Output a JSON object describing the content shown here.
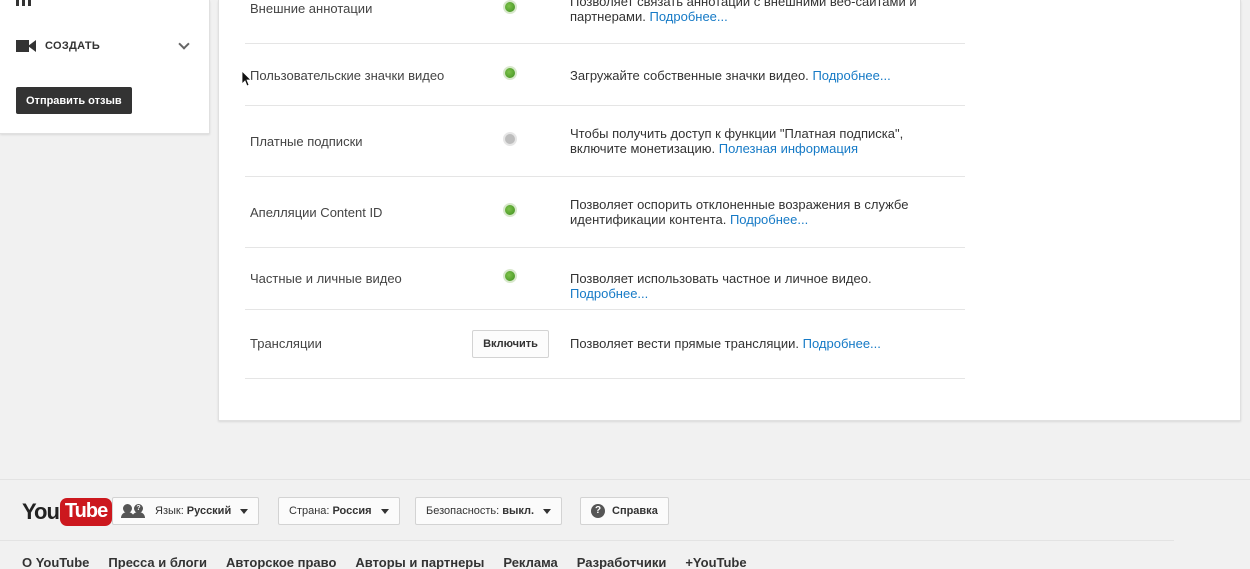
{
  "guide": {
    "create_label": "СОЗДАТЬ",
    "feedback_label": "Отправить отзыв"
  },
  "features": [
    {
      "name": "Внешние аннотации",
      "status": "on",
      "desc": "Позволяет связать аннотации с внешними веб-сайтами и партнерами.",
      "link": "Подробнее..."
    },
    {
      "name": "Пользовательские значки видео",
      "status": "on",
      "desc": "Загружайте собственные значки видео.",
      "link": "Подробнее..."
    },
    {
      "name": "Платные подписки",
      "status": "off",
      "desc": "Чтобы получить доступ к функции \"Платная подписка\", включите монетизацию.",
      "link": "Полезная информация"
    },
    {
      "name": "Апелляции Content ID",
      "status": "on",
      "desc": "Позволяет оспорить отклоненные возражения в службе идентификации контента.",
      "link": "Подробнее..."
    },
    {
      "name": "Частные и личные видео",
      "status": "on",
      "desc": "Позволяет использовать частное и личное видео.",
      "link": "Подробнее..."
    },
    {
      "name": "Трансляции",
      "status": "button",
      "button_label": "Включить",
      "desc": "Позволяет вести прямые трансляции.",
      "link": "Подробнее..."
    }
  ],
  "footer": {
    "logo_you": "You",
    "logo_tube": "Tube",
    "language_label": "Язык:",
    "language_value": "Русский",
    "country_label": "Страна:",
    "country_value": "Россия",
    "safety_label": "Безопасность:",
    "safety_value": "выкл.",
    "help_label": "Справка",
    "help_glyph": "?",
    "links": [
      "О YouTube",
      "Пресса и блоги",
      "Авторское право",
      "Авторы и партнеры",
      "Реклама",
      "Разработчики",
      "+YouTube"
    ]
  },
  "colors": {
    "accent_link": "#167ac6",
    "status_on": "#4a9a2a",
    "status_off": "#bdbdbd",
    "youtube_red": "#cc181e"
  }
}
